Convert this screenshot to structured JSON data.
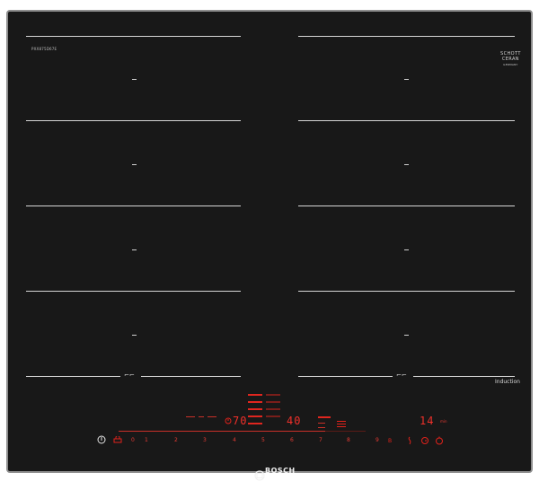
{
  "hob": {
    "model_number": "PXX875D67E",
    "glass_brand": {
      "line1": "SCHOTT",
      "line2": "CERAN",
      "line3": "GERMANY"
    },
    "flex_symbol": "⌐⌐",
    "induction_label": "Induction",
    "brand_label": "BOSCH"
  },
  "panel": {
    "timer_value": "70",
    "power_value": "40",
    "right_timer_value": "14",
    "right_timer_unit": "min",
    "scale_labels": [
      "0",
      "1",
      "2",
      "3",
      "4",
      "5",
      "6",
      "7",
      "8",
      "9"
    ],
    "colors": {
      "accent": "#e1221b",
      "glass": "#181818",
      "frame": "#8e8e8e"
    }
  }
}
